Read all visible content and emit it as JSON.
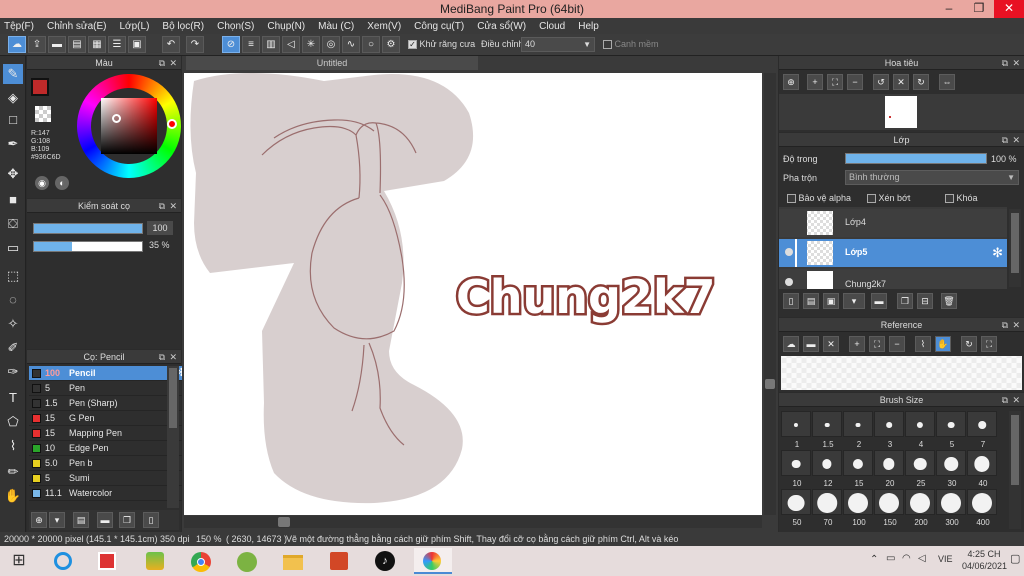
{
  "titlebar": {
    "title": "MediBang Paint Pro (64bit)",
    "min": "–",
    "max": "❐",
    "close": "✕"
  },
  "menu": [
    "Tệp(F)",
    "Chỉnh sửa(E)",
    "Lớp(L)",
    "Bộ lọc(R)",
    "Chọn(S)",
    "Chụp(N)",
    "Màu (C)",
    "Xem(V)",
    "Công cụ(T)",
    "Cửa sổ(W)",
    "Cloud",
    "Help"
  ],
  "toolbar": {
    "antialias_label": "Khử răng cưa",
    "adjust_label": "Điều chỉnh",
    "adjust_value": "40",
    "edge_label": "Canh mềm"
  },
  "color_panel": {
    "title": "Màu",
    "r": "R:147",
    "g": "G:108",
    "b": "B:109",
    "hex": "#936C6D",
    "fg_color": "#936c6d"
  },
  "brush_control": {
    "title": "Kiểm soát cọ",
    "size": "100",
    "opacity": "35 %",
    "size_fraction": 1.0,
    "opacity_fraction": 0.35
  },
  "brush_list": {
    "title": "Cọ: Pencil",
    "items": [
      {
        "size": "100",
        "name": "Pencil",
        "color": "#333333"
      },
      {
        "size": "5",
        "name": "Pen",
        "color": "#333333"
      },
      {
        "size": "1.5",
        "name": "Pen (Sharp)",
        "color": "#333333"
      },
      {
        "size": "15",
        "name": "G Pen",
        "color": "#e83030"
      },
      {
        "size": "15",
        "name": "Mapping Pen",
        "color": "#e83030"
      },
      {
        "size": "10",
        "name": "Edge Pen",
        "color": "#2aa52a"
      },
      {
        "size": "5.0",
        "name": "Pen b",
        "color": "#e8d020"
      },
      {
        "size": "5",
        "name": "Sumi",
        "color": "#e8d020"
      },
      {
        "size": "11.1",
        "name": "Watercolor",
        "color": "#7ab8ea"
      }
    ]
  },
  "canvas": {
    "doc_title": "Untitled",
    "text": "Chung2k7",
    "text_color": "#ffffff",
    "outline_color": "#8a3b34",
    "shape_color": "#d8cfcf",
    "line_color": "#9b6e6e"
  },
  "navigator": {
    "title": "Hoa tiêu"
  },
  "layer_panel": {
    "title": "Lớp",
    "opacity_label": "Độ trong",
    "opacity_value": "100 %",
    "opacity_fraction": 1.0,
    "blend_label": "Pha trộn",
    "blend_value": "Bình thường",
    "protect_alpha": "Bảo vệ alpha",
    "clipping": "Xén bớt",
    "lock": "Khóa",
    "layers": [
      {
        "name": "Lớp4",
        "selected": false
      },
      {
        "name": "Lớp5",
        "selected": true
      },
      {
        "name": "Chung2k7",
        "selected": false
      }
    ]
  },
  "reference": {
    "title": "Reference"
  },
  "brush_size": {
    "title": "Brush Size",
    "sizes": [
      "1",
      "1.5",
      "2",
      "3",
      "4",
      "5",
      "7",
      "10",
      "12",
      "15",
      "20",
      "25",
      "30",
      "40",
      "50",
      "70",
      "100",
      "150",
      "200",
      "300",
      "400"
    ]
  },
  "status": {
    "canvas_size": "20000 * 20000 pixel",
    "physical": "(145.1 * 145.1cm)",
    "dpi": "350 dpi",
    "zoom": "150 %",
    "coords": "( 2630, 14673 )",
    "hint": "Vẽ một đường thẳng bằng cách giữ phím Shift, Thay đổi cỡ cọ bằng cách giữ phím Ctrl, Alt và kéo"
  },
  "taskbar": {
    "lang": "VIE",
    "time": "4:25 CH",
    "date": "04/06/2021"
  }
}
